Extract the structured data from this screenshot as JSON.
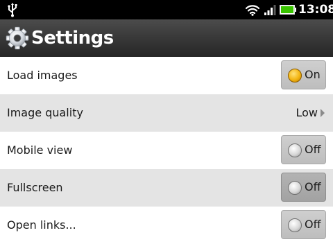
{
  "status_bar": {
    "usb_icon": "usb-icon",
    "wifi_icon": "wifi-icon",
    "signal_icon": "signal-icon",
    "battery_icon": "battery-icon",
    "time": "13:08"
  },
  "header": {
    "icon": "gear-icon",
    "title": "Settings"
  },
  "settings": [
    {
      "label": "Load images",
      "type": "toggle",
      "state": "On"
    },
    {
      "label": "Image quality",
      "type": "value",
      "value": "Low"
    },
    {
      "label": "Mobile view",
      "type": "toggle",
      "state": "Off"
    },
    {
      "label": "Fullscreen",
      "type": "toggle",
      "state": "Off"
    },
    {
      "label": "Open links...",
      "type": "toggle",
      "state": "Off"
    }
  ],
  "colors": {
    "status_bar": "#000000",
    "title_bar": "#3a3a3a",
    "row_light": "#ffffff",
    "row_alt": "#e4e4e4",
    "battery_green": "#39c400",
    "toggle_on": "#f3b512"
  }
}
